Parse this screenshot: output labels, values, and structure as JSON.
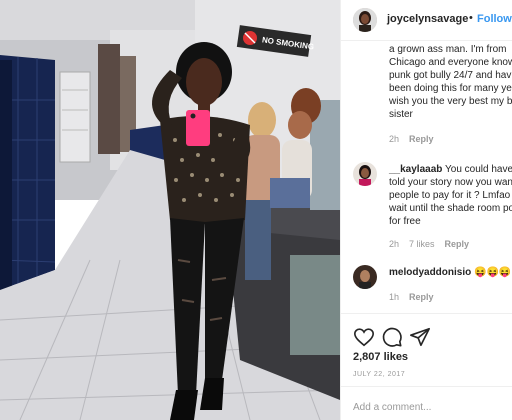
{
  "post": {
    "username": "joycelynsavage",
    "separator": "•",
    "follow_label": "Follow",
    "sign_text": "NO SMOKING"
  },
  "comments": [
    {
      "lines": [
        "a grown ass man. I'm from",
        "Chicago and everyone know",
        "punk got bully 24/7 and hav",
        "been doing this for many ye",
        "wish you the very best my bl",
        "sister"
      ],
      "time": "2h",
      "reply": "Reply"
    },
    {
      "username": "__kaylaaab",
      "lines_first": "You could have b",
      "lines": [
        "told your story now you wan",
        "people to pay for it ? Lmfao",
        "wait until the shade room po",
        "for free"
      ],
      "time": "2h",
      "likes": "7 likes",
      "reply": "Reply"
    },
    {
      "username": "melodyaddonisio",
      "emojis": "😝😝😝",
      "time": "1h",
      "reply": "Reply"
    }
  ],
  "icons": {
    "like": "heart-icon",
    "comment": "comment-icon",
    "share": "share-icon"
  },
  "footer": {
    "likes": "2,807 likes",
    "date": "JULY 22, 2017",
    "add_comment_placeholder": "Add a comment..."
  },
  "colors": {
    "follow": "#3897f0",
    "muted": "#999999",
    "text": "#262626",
    "phone_case": "#ff3d7f",
    "tile_blue": "#1a2a5e"
  }
}
